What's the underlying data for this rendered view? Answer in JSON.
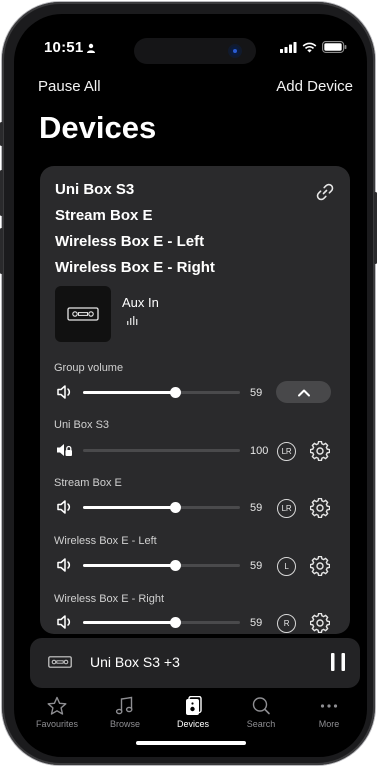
{
  "status_bar": {
    "time": "10:51"
  },
  "header": {
    "pause_all": "Pause All",
    "add_device": "Add Device",
    "title": "Devices"
  },
  "group": {
    "names": [
      "Uni Box S3",
      "Stream Box E",
      "Wireless Box E - Left",
      "Wireless Box E - Right"
    ],
    "now_playing": "Aux In",
    "group_volume_label": "Group volume",
    "group_volume": 59
  },
  "devices": [
    {
      "name": "Uni Box S3",
      "volume": "100",
      "level": 0.0,
      "badge": "LR",
      "muted": true
    },
    {
      "name": "Stream Box E",
      "volume": "59",
      "level": 0.59,
      "badge": "LR",
      "muted": false
    },
    {
      "name": "Wireless Box E - Left",
      "volume": "59",
      "level": 0.59,
      "badge": "L",
      "muted": false
    },
    {
      "name": "Wireless Box E - Right",
      "volume": "59",
      "level": 0.59,
      "badge": "R",
      "muted": false
    }
  ],
  "mini_player": {
    "title": "Uni Box S3 +3"
  },
  "tabs": [
    {
      "label": "Favourites",
      "icon": "star-icon"
    },
    {
      "label": "Browse",
      "icon": "music-note-icon"
    },
    {
      "label": "Devices",
      "icon": "devices-icon",
      "active": true
    },
    {
      "label": "Search",
      "icon": "search-icon"
    },
    {
      "label": "More",
      "icon": "more-icon"
    }
  ],
  "colors": {
    "background": "#000000",
    "card": "#2a2a2c",
    "accent": "#ffffff"
  }
}
